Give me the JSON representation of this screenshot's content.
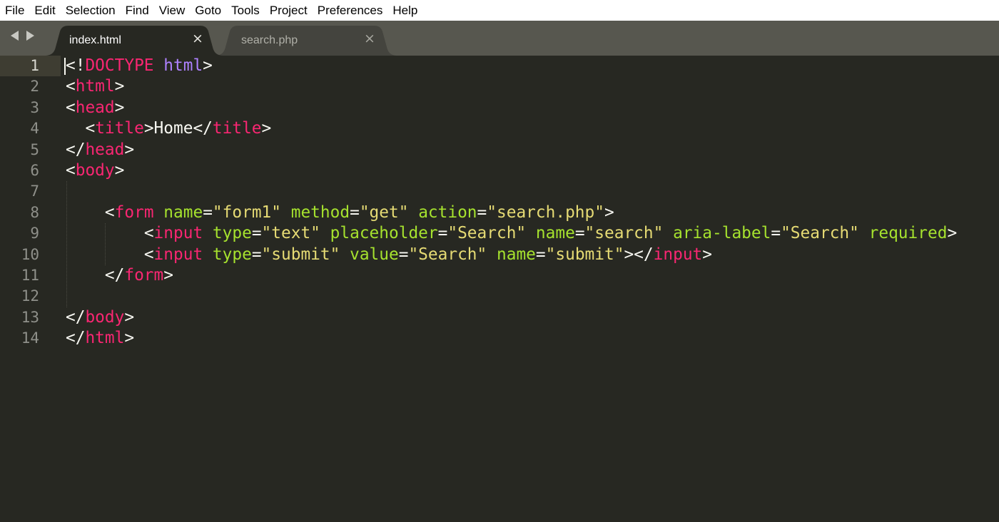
{
  "menu": [
    "File",
    "Edit",
    "Selection",
    "Find",
    "View",
    "Goto",
    "Tools",
    "Project",
    "Preferences",
    "Help"
  ],
  "tabs": [
    {
      "label": "index.html",
      "close": "×",
      "active": true
    },
    {
      "label": "search.php",
      "close": "×",
      "active": false
    }
  ],
  "editor": {
    "active_line": 1,
    "line_numbers": [
      "1",
      "2",
      "3",
      "4",
      "5",
      "6",
      "7",
      "8",
      "9",
      "10",
      "11",
      "12",
      "13",
      "14"
    ],
    "syntax_colors": {
      "background": "#272822",
      "tag": "#f92672",
      "attribute": "#a6e22e",
      "string": "#e6db74",
      "keyword": "#ae81ff",
      "text": "#f8f8f2"
    },
    "lines": [
      [
        [
          "punc",
          "<!"
        ],
        [
          "tag",
          "DOCTYPE"
        ],
        [
          "txt",
          " "
        ],
        [
          "kw",
          "html"
        ],
        [
          "punc",
          ">"
        ]
      ],
      [
        [
          "punc",
          "<"
        ],
        [
          "tag",
          "html"
        ],
        [
          "punc",
          ">"
        ]
      ],
      [
        [
          "punc",
          "<"
        ],
        [
          "tag",
          "head"
        ],
        [
          "punc",
          ">"
        ]
      ],
      [
        [
          "txt",
          "  "
        ],
        [
          "punc",
          "<"
        ],
        [
          "tag",
          "title"
        ],
        [
          "punc",
          ">"
        ],
        [
          "txt",
          "Home"
        ],
        [
          "punc",
          "</"
        ],
        [
          "tag",
          "title"
        ],
        [
          "punc",
          ">"
        ]
      ],
      [
        [
          "punc",
          "</"
        ],
        [
          "tag",
          "head"
        ],
        [
          "punc",
          ">"
        ]
      ],
      [
        [
          "punc",
          "<"
        ],
        [
          "tag",
          "body"
        ],
        [
          "punc",
          ">"
        ]
      ],
      [],
      [
        [
          "txt",
          "    "
        ],
        [
          "punc",
          "<"
        ],
        [
          "tag",
          "form"
        ],
        [
          "txt",
          " "
        ],
        [
          "attr",
          "name"
        ],
        [
          "punc",
          "="
        ],
        [
          "str",
          "\"form1\""
        ],
        [
          "txt",
          " "
        ],
        [
          "attr",
          "method"
        ],
        [
          "punc",
          "="
        ],
        [
          "str",
          "\"get\""
        ],
        [
          "txt",
          " "
        ],
        [
          "attr",
          "action"
        ],
        [
          "punc",
          "="
        ],
        [
          "str",
          "\"search.php\""
        ],
        [
          "punc",
          ">"
        ]
      ],
      [
        [
          "txt",
          "        "
        ],
        [
          "punc",
          "<"
        ],
        [
          "tag",
          "input"
        ],
        [
          "txt",
          " "
        ],
        [
          "attr",
          "type"
        ],
        [
          "punc",
          "="
        ],
        [
          "str",
          "\"text\""
        ],
        [
          "txt",
          " "
        ],
        [
          "attr",
          "placeholder"
        ],
        [
          "punc",
          "="
        ],
        [
          "str",
          "\"Search\""
        ],
        [
          "txt",
          " "
        ],
        [
          "attr",
          "name"
        ],
        [
          "punc",
          "="
        ],
        [
          "str",
          "\"search\""
        ],
        [
          "txt",
          " "
        ],
        [
          "attr",
          "aria-label"
        ],
        [
          "punc",
          "="
        ],
        [
          "str",
          "\"Search\""
        ],
        [
          "txt",
          " "
        ],
        [
          "attr",
          "required"
        ],
        [
          "punc",
          ">"
        ]
      ],
      [
        [
          "txt",
          "        "
        ],
        [
          "punc",
          "<"
        ],
        [
          "tag",
          "input"
        ],
        [
          "txt",
          " "
        ],
        [
          "attr",
          "type"
        ],
        [
          "punc",
          "="
        ],
        [
          "str",
          "\"submit\""
        ],
        [
          "txt",
          " "
        ],
        [
          "attr",
          "value"
        ],
        [
          "punc",
          "="
        ],
        [
          "str",
          "\"Search\""
        ],
        [
          "txt",
          " "
        ],
        [
          "attr",
          "name"
        ],
        [
          "punc",
          "="
        ],
        [
          "str",
          "\"submit\""
        ],
        [
          "punc",
          "></"
        ],
        [
          "tag",
          "input"
        ],
        [
          "punc",
          ">"
        ]
      ],
      [
        [
          "txt",
          "    "
        ],
        [
          "punc",
          "</"
        ],
        [
          "tag",
          "form"
        ],
        [
          "punc",
          ">"
        ]
      ],
      [],
      [
        [
          "punc",
          "</"
        ],
        [
          "tag",
          "body"
        ],
        [
          "punc",
          ">"
        ]
      ],
      [
        [
          "punc",
          "</"
        ],
        [
          "tag",
          "html"
        ],
        [
          "punc",
          ">"
        ]
      ]
    ]
  }
}
